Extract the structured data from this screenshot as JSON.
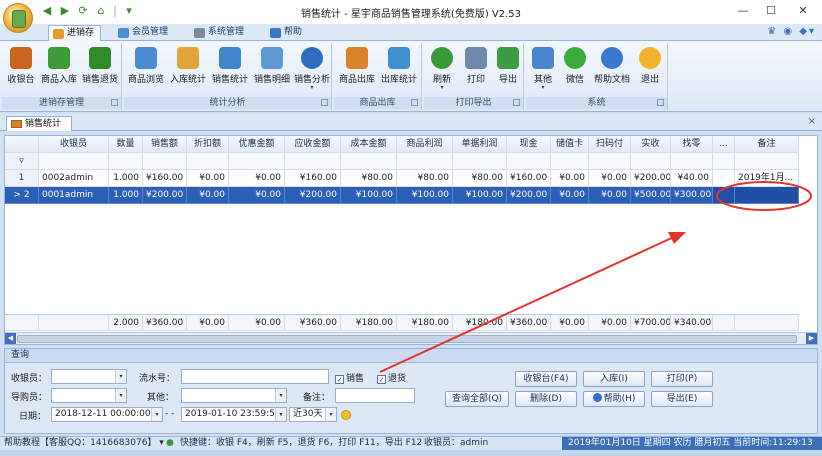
{
  "window": {
    "title": "销售统计 - 星宇商品销售管理系统(免费版) V2.53",
    "minimize": "—",
    "maximize": "☐",
    "close": "✕"
  },
  "quick_access": [
    "◀",
    "▶",
    "⟳",
    "⌂",
    "|",
    "▾"
  ],
  "tabs": [
    {
      "label": "进销存",
      "icon_color": "#e39b2b"
    },
    {
      "label": "会员管理",
      "icon_color": "#4d8fd6"
    },
    {
      "label": "系统管理",
      "icon_color": "#7a8c99"
    },
    {
      "label": "帮助",
      "icon_color": "#3c78c8"
    }
  ],
  "tabrow_right": "♛ ◉ ◆▾",
  "ribbon_groups": [
    {
      "label": "进销存管理",
      "buttons": [
        {
          "label": "收银台",
          "icon": "cashier-icon",
          "color": "#c9651e"
        },
        {
          "label": "商品入库",
          "icon": "stock-in-icon",
          "color": "#3f9a3a"
        },
        {
          "label": "销售退货",
          "icon": "return-icon",
          "color": "#2f8a2a"
        }
      ]
    },
    {
      "label": "统计分析",
      "buttons": [
        {
          "label": "商品浏览",
          "icon": "browse-icon",
          "color": "#4c8bd1"
        },
        {
          "label": "入库统计",
          "icon": "stock-stats-icon",
          "color": "#e0a43a"
        },
        {
          "label": "销售统计",
          "icon": "sales-stats-icon",
          "color": "#3e86c9"
        },
        {
          "label": "销售明细",
          "icon": "sales-detail-icon",
          "color": "#5b9ad6"
        },
        {
          "label": "销售分析",
          "icon": "pie-chart-icon",
          "color": "#2e6cbf",
          "dropdown": "▾"
        }
      ]
    },
    {
      "label": "商品出库",
      "buttons": [
        {
          "label": "商品出库",
          "icon": "stock-out-icon",
          "color": "#d9822b"
        },
        {
          "label": "出库统计",
          "icon": "out-stats-icon",
          "color": "#3f8fd1"
        }
      ]
    },
    {
      "label": "打印导出",
      "buttons": [
        {
          "label": "刷新",
          "icon": "refresh-icon",
          "color": "#3a9a3a",
          "dropdown": "▾"
        },
        {
          "label": "打印",
          "icon": "print-icon",
          "color": "#6f8aa8"
        },
        {
          "label": "导出",
          "icon": "export-icon",
          "color": "#3d9b45"
        }
      ]
    },
    {
      "label": "系统",
      "buttons": [
        {
          "label": "其他",
          "icon": "other-icon",
          "color": "#4a86cf",
          "dropdown": "▾"
        },
        {
          "label": "微信",
          "icon": "wechat-icon",
          "color": "#3bab3b"
        },
        {
          "label": "帮助文档",
          "icon": "help-icon",
          "color": "#3b78d0"
        },
        {
          "label": "退出",
          "icon": "exit-icon",
          "color": "#f0b22a"
        }
      ]
    }
  ],
  "doc_tab": {
    "label": "销售统计",
    "close": "×"
  },
  "grid": {
    "columns": [
      "",
      "收银员",
      "数量",
      "销售额",
      "折扣额",
      "优惠金额",
      "应收金额",
      "成本金额",
      "商品利润",
      "单据利润",
      "现金",
      "储值卡",
      "扫码付",
      "实收",
      "找零",
      "...",
      "备注"
    ],
    "filter_indicator": "▿",
    "rows": [
      {
        "ind": "1",
        "values": [
          "0002",
          "admin",
          "1.000",
          "¥160.00",
          "¥0.00",
          "¥0.00",
          "¥160.00",
          "¥80.00",
          "¥80.00",
          "¥80.00",
          "¥160.00",
          "¥0.00",
          "¥0.00",
          "¥200.00",
          "¥40.00",
          "",
          "2019年1月..."
        ]
      },
      {
        "ind": "> 2",
        "values": [
          "0001",
          "admin",
          "1.000",
          "¥200.00",
          "¥0.00",
          "¥0.00",
          "¥200.00",
          "¥100.00",
          "¥100.00",
          "¥100.00",
          "¥200.00",
          "¥0.00",
          "¥0.00",
          "¥500.00",
          "¥300.00",
          "",
          ""
        ]
      }
    ],
    "footer": [
      "",
      "",
      "2.000",
      "¥360.00",
      "¥0.00",
      "¥0.00",
      "¥360.00",
      "¥180.00",
      "¥180.00",
      "¥180.00",
      "¥360.00",
      "¥0.00",
      "¥0.00",
      "¥700.00",
      "¥340.00",
      "",
      ""
    ],
    "scroll_left": "◀",
    "scroll_right": "▶"
  },
  "query": {
    "title": "查询",
    "cashier_label": "收银员：",
    "serial_label": "流水号：",
    "sales_check": "销售",
    "return_check": "退货",
    "check_mark": "✓",
    "guide_label": "导购员：",
    "other_label": "其他：",
    "remark_label": "备注：",
    "date_label": "日期：",
    "date_from": "2018-12-11 00:00:00",
    "date_sep": "- -",
    "date_to": "2019-01-10 23:59:59",
    "range": "近30天",
    "dropdown_arrow": "▾",
    "btn_cashier": "收银台(F4)",
    "btn_stockin": "入库(I)",
    "btn_print": "打印(P)",
    "btn_query_all": "查询全部(Q)",
    "btn_delete": "删除(D)",
    "btn_help": "帮助(H)",
    "btn_export": "导出(E)"
  },
  "status": {
    "help": "帮助教程【客服QQ：1416683076】 ▾",
    "shortcuts": "快捷键：收银 F4，刷新 F5，退货 F6，打印 F11，导出 F12",
    "cashier": "收银员：admin",
    "datetime": "2019年01月10日 星期四 农历 腊月初五 当前时间:11:29:13"
  },
  "colors": {
    "selection": "#2c5fb8",
    "annotation": "#e5332a"
  }
}
